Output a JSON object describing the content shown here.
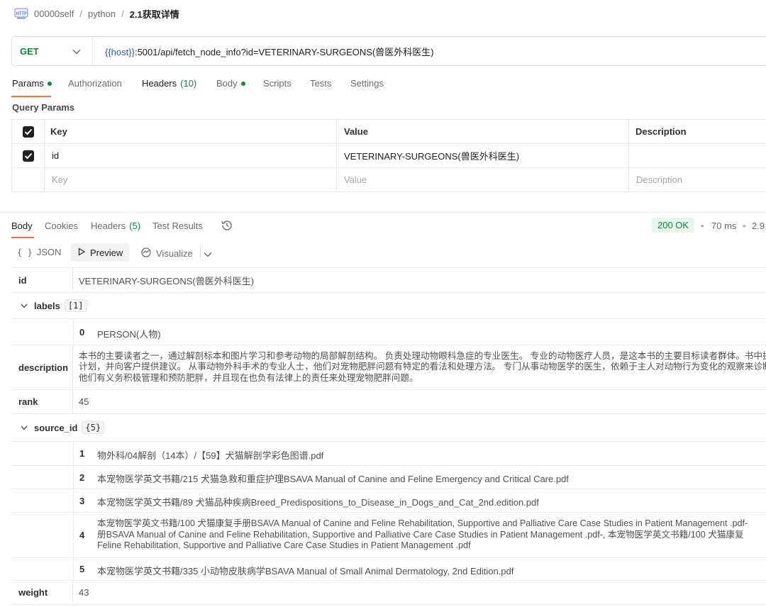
{
  "breadcrumb": {
    "workspace": "00000self",
    "sep1": "/",
    "collection": "python",
    "sep2": "/",
    "current": "2.1获取详情"
  },
  "request": {
    "method": "GET",
    "url_var": "{{host}}",
    "url_rest": ":5001/api/fetch_node_info?id=VETERINARY-SURGEONS(兽医外科医生)"
  },
  "req_tabs": {
    "params": "Params",
    "authorization": "Authorization",
    "headers": "Headers",
    "headers_count": "(10)",
    "body": "Body",
    "scripts": "Scripts",
    "tests": "Tests",
    "settings": "Settings"
  },
  "query_params": {
    "title": "Query Params",
    "col_key": "Key",
    "col_value": "Value",
    "col_description": "Description",
    "row_key": "id",
    "row_value": "VETERINARY-SURGEONS(兽医外科医生)",
    "placeholder_key": "Key",
    "placeholder_value": "Value",
    "placeholder_description": "Description"
  },
  "resp_tabs": {
    "body": "Body",
    "cookies": "Cookies",
    "headers": "Headers",
    "headers_count": "(5)",
    "test_results": "Test Results"
  },
  "status": {
    "code": "200 OK",
    "sep": "•",
    "time": "70 ms",
    "sep2": "•",
    "size": "2.9"
  },
  "view": {
    "json": "JSON",
    "preview": "Preview",
    "visualize": "Visualize"
  },
  "result": {
    "id_key": "id",
    "id_value": "VETERINARY-SURGEONS(兽医外科医生)",
    "labels_key": "labels",
    "labels_count": "[1]",
    "labels_idx": "0",
    "labels_value": "PERSON(人物)",
    "description_key": "description",
    "description_line1": "本书的主要读者之一，通过解剖标本和图片学习和参考动物的局部解剖结构。 负责处理动物眼科急症的专业医生。 专业的动物医疗人员，是这本书的主要目标读者群体。书中提",
    "description_line2": "计划，并向客户提供建议。 从事动物外科手术的专业人士，他们对宠物肥胖问题有特定的看法和处理方法。 专门从事动物医学的医生，依赖于主人对动物行为变化的观察来诊断",
    "description_line3": "他们有义务积极管理和预防肥胖，并且现在也负有法律上的责任来处理宠物肥胖问题。",
    "rank_key": "rank",
    "rank_value": "45",
    "source_key": "source_id",
    "source_count": "{5}",
    "sources": [
      {
        "idx": "1",
        "text": "物外科/04解剖（14本）/【59】犬猫解剖学彩色图谱.pdf"
      },
      {
        "idx": "2",
        "text": "本宠物医学英文书籍/215 犬猫急救和重症护理BSAVA Manual of Canine and Feline Emergency and Critical Care.pdf"
      },
      {
        "idx": "3",
        "text": "本宠物医学英文书籍/89 犬猫品种疾病Breed_Predispositions_to_Disease_in_Dogs_and_Cat_2nd.edition.pdf"
      },
      {
        "idx": "4",
        "line1": "本宠物医学英文书籍/100 犬猫康复手册BSAVA Manual of Canine and Feline Rehabilitation, Supportive and Palliative Care Case Studies in Patient Management .pdf-",
        "line2": "册BSAVA Manual of Canine and Feline Rehabilitation, Supportive and Palliative Care Case Studies in Patient Management .pdf-, 本宠物医学英文书籍/100 犬猫康复",
        "line3": "Feline Rehabilitation, Supportive and Palliative Care Case Studies in Patient Management .pdf"
      },
      {
        "idx": "5",
        "text": "本宠物医学英文书籍/335 小动物皮肤病学BSAVA Manual of Small Animal Dermatology, 2nd Edition.pdf"
      }
    ],
    "weight_key": "weight",
    "weight_value": "43"
  }
}
